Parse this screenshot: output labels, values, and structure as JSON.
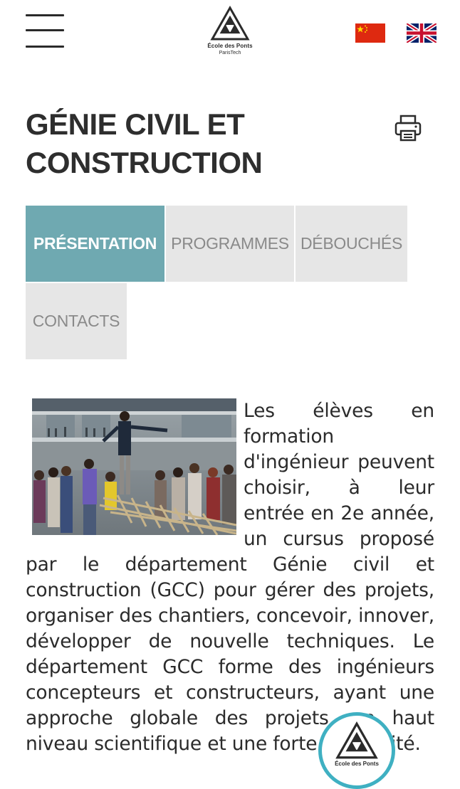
{
  "header": {
    "menu_icon": "hamburger-menu-icon",
    "logo": {
      "line1": "École des Ponts",
      "line2": "ParisTech"
    },
    "languages": [
      {
        "code": "zh",
        "icon": "china-flag-icon"
      },
      {
        "code": "en",
        "icon": "uk-flag-icon"
      }
    ]
  },
  "page": {
    "title": "GÉNIE CIVIL ET CONSTRUCTION",
    "print_icon": "printer-icon"
  },
  "tabs": [
    {
      "label": "PRÉSENTATION",
      "active": true
    },
    {
      "label": "PROGRAMMES",
      "active": false
    },
    {
      "label": "DÉBOUCHÉS",
      "active": false
    },
    {
      "label": "CONTACTS",
      "active": false
    }
  ],
  "content": {
    "image_subject": "students on bamboo bridge structure",
    "paragraph": "Les élèves en formation d'ingénieur peuvent choisir, à leur entrée en 2e année, un cursus proposé par le département Génie civil et construction (GCC) pour gérer des projets, organiser des chantiers, concevoir, innover, développer de nouvelle techniques. Le département GCC forme des ingénieurs concepteurs et constructeurs, ayant une approche globale des projets, un haut niveau scientifique et une forte technicité."
  },
  "badge": {
    "label": "École des Ponts"
  },
  "colors": {
    "accent": "#6fa9b1",
    "tab_inactive": "#e6e6e6",
    "badge_ring": "#3fb0c2",
    "text": "#2b2b2b"
  }
}
